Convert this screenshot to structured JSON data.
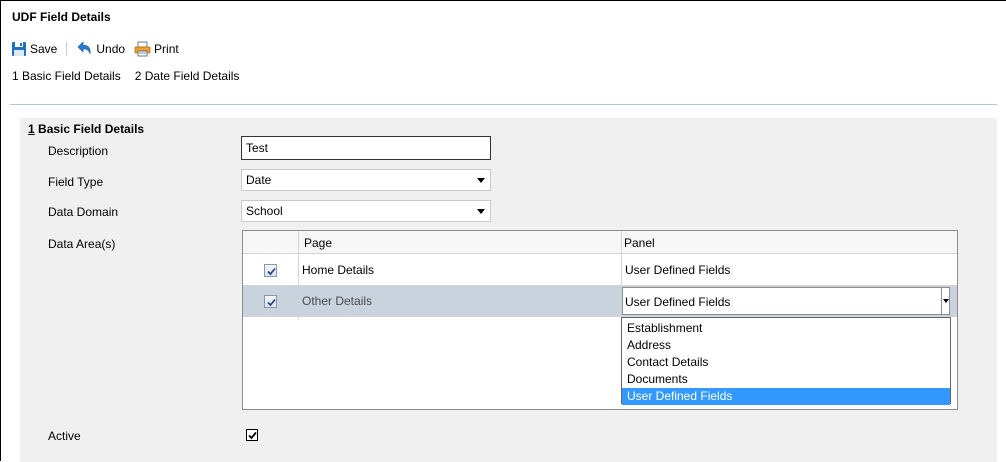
{
  "window": {
    "title": "UDF Field Details"
  },
  "toolbar": {
    "save_label": "Save",
    "undo_label": "Undo",
    "print_label": "Print",
    "save_icon": "floppy-disk-icon",
    "undo_icon": "undo-arrow-icon",
    "print_icon": "printer-icon"
  },
  "nav": {
    "links": [
      "1 Basic Field Details",
      "2 Date Field Details"
    ]
  },
  "section": {
    "number": "1",
    "title": "Basic Field Details"
  },
  "fields": {
    "description": {
      "label": "Description",
      "value": "Test"
    },
    "field_type": {
      "label": "Field Type",
      "value": "Date"
    },
    "data_domain": {
      "label": "Data Domain",
      "value": "School"
    },
    "data_areas": {
      "label": "Data Area(s)"
    },
    "active": {
      "label": "Active",
      "checked": true
    }
  },
  "grid": {
    "columns": [
      "Page",
      "Panel"
    ],
    "rows": [
      {
        "checked": true,
        "page": "Home Details",
        "panel": "User Defined Fields"
      },
      {
        "checked": true,
        "page": "Other Details",
        "panel": "User Defined Fields"
      }
    ]
  },
  "dropdown": {
    "options": [
      "Establishment",
      "Address",
      "Contact Details",
      "Documents",
      "User Defined Fields"
    ],
    "selected": "User Defined Fields"
  },
  "colors": {
    "selection": "#3399ff",
    "header_rule": "#b4c6db",
    "panel_bg": "#f0f0f0",
    "selected_row": "#c9d3de"
  }
}
